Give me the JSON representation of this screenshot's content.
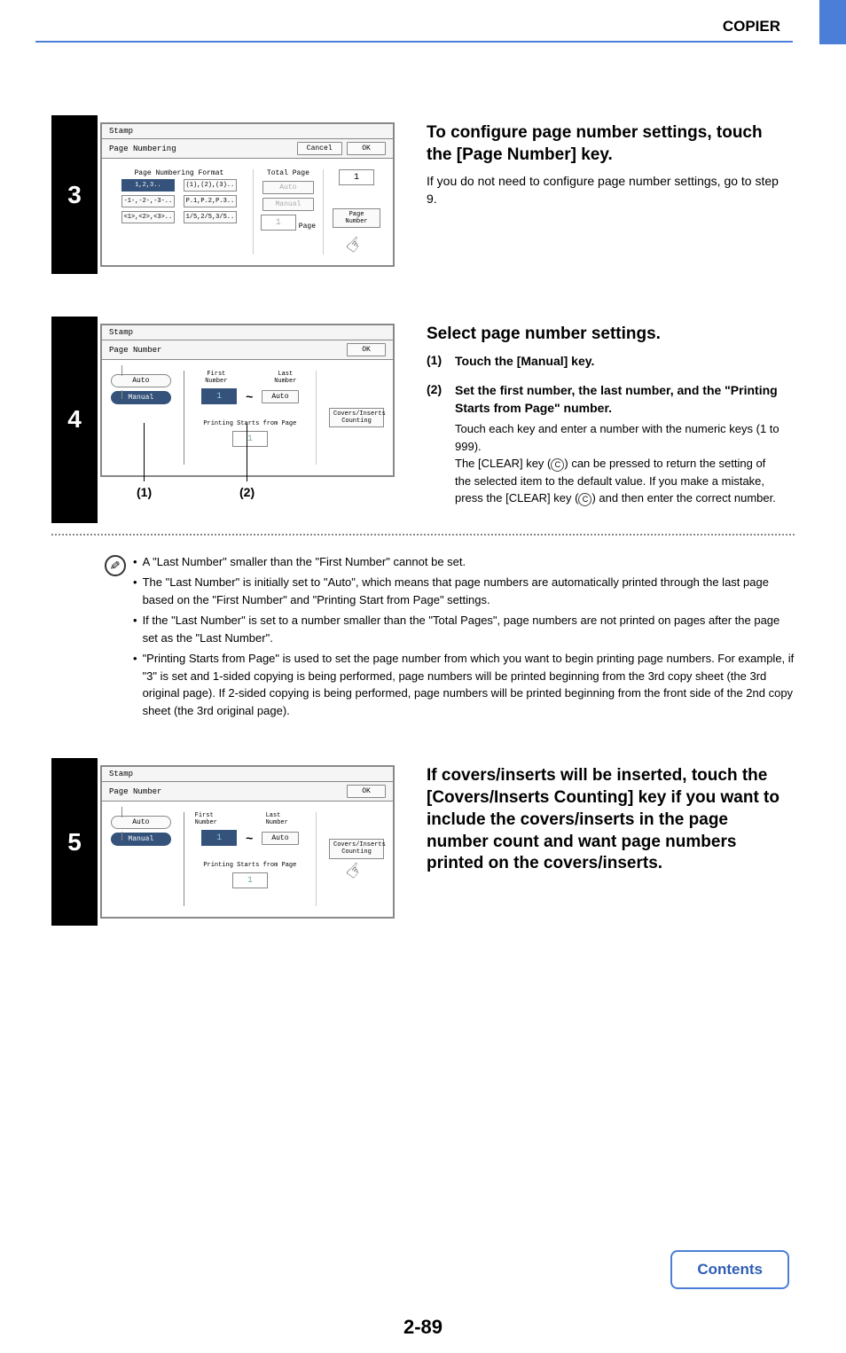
{
  "header": {
    "title": "COPIER"
  },
  "step3": {
    "number": "3",
    "screen": {
      "tab": "Stamp",
      "title": "Page Numbering",
      "cancel": "Cancel",
      "ok": "OK",
      "format_label": "Page Numbering Format",
      "formats": [
        "1,2,3..",
        "(1),(2),(3)..",
        "-1-,-2-,-3-..",
        "P.1,P.2,P.3..",
        "<1>,<2>,<3>..",
        "1/5,2/5,3/5.."
      ],
      "total_page_label": "Total Page",
      "auto": "Auto",
      "manual": "Manual",
      "num_value": "1",
      "page_label": "Page",
      "pn_value": "1",
      "page_number_btn": "Page Number"
    },
    "heading": "To configure page number settings, touch the [Page Number] key.",
    "body": "If you do not need to configure page number settings, go to step 9."
  },
  "step4": {
    "number": "4",
    "screen": {
      "tab": "Stamp",
      "title": "Page Number",
      "ok": "OK",
      "auto": "Auto",
      "manual": "Manual",
      "first_label": "First Number",
      "last_label": "Last Number",
      "first_value": "1",
      "last_value": "Auto",
      "printing_label": "Printing Starts from Page",
      "printing_value": "1",
      "covers_btn_l1": "Covers/Inserts",
      "covers_btn_l2": "Counting"
    },
    "callout1": "(1)",
    "callout2": "(2)",
    "heading": "Select page number settings.",
    "item1_num": "(1)",
    "item1_heading": "Touch the [Manual] key.",
    "item2_num": "(2)",
    "item2_heading": "Set the first number, the last number, and the \"Printing Starts from Page\" number.",
    "item2_body1": "Touch each key and enter a number with the numeric keys (1 to 999).",
    "item2_body2a": "The [CLEAR] key (",
    "item2_body2b": ") can be pressed to return the setting of the selected item to the default value. If you make a mistake, press the [CLEAR] key (",
    "item2_body2c": ") and then enter the correct number.",
    "clear_glyph": "C",
    "notes": [
      "A \"Last Number\" smaller than the \"First Number\" cannot be set.",
      "The \"Last Number\" is initially set to \"Auto\", which means that page numbers are automatically printed through the last page based on the \"First Number\" and \"Printing Start from Page\" settings.",
      "If the \"Last Number\" is set to a number smaller than the \"Total Pages\", page numbers are not printed on pages after the page set as the \"Last Number\".",
      "\"Printing Starts from Page\" is used to set the page number from which you want to begin printing page numbers. For example, if \"3\" is set and 1-sided copying is being performed, page numbers will be printed beginning from the 3rd copy sheet (the 3rd original page). If 2-sided copying is being performed, page numbers will be printed beginning from the front side of the 2nd copy sheet (the 3rd original page)."
    ]
  },
  "step5": {
    "number": "5",
    "screen": {
      "tab": "Stamp",
      "title": "Page Number",
      "ok": "OK",
      "auto": "Auto",
      "manual": "Manual",
      "first_label": "First Number",
      "last_label": "Last Number",
      "first_value": "1",
      "last_value": "Auto",
      "printing_label": "Printing Starts from Page",
      "printing_value": "1",
      "covers_btn_l1": "Covers/Inserts",
      "covers_btn_l2": "Counting"
    },
    "heading": "If covers/inserts will be inserted, touch the [Covers/Inserts Counting] key if you want to include the covers/inserts in the page number count and want page numbers printed on the covers/inserts."
  },
  "footer": {
    "page": "2-89",
    "contents": "Contents"
  }
}
